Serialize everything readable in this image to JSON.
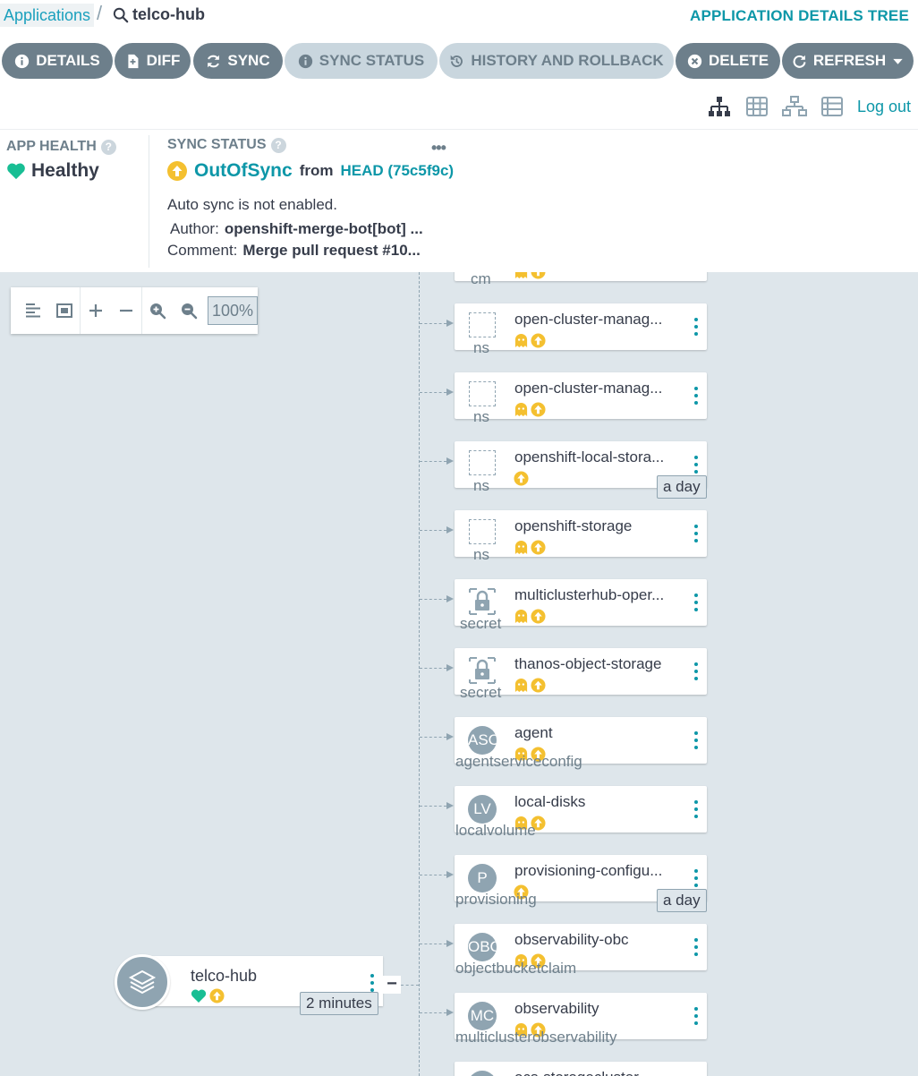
{
  "breadcrumb": {
    "apps": "Applications",
    "current": "telco-hub"
  },
  "view_title": "APPLICATION DETAILS TREE",
  "toolbar": {
    "details": "DETAILS",
    "diff": "DIFF",
    "sync": "SYNC",
    "sync_status": "SYNC STATUS",
    "history": "HISTORY AND ROLLBACK",
    "delete": "DELETE",
    "refresh": "REFRESH"
  },
  "logout": "Log out",
  "app_health": {
    "title": "APP HEALTH",
    "value": "Healthy"
  },
  "sync_status": {
    "title": "SYNC STATUS",
    "value": "OutOfSync",
    "from": "from",
    "revision": "HEAD (75c5f9c)",
    "auto_sync": "Auto sync is not enabled.",
    "author_label": "Author:",
    "author": "openshift-merge-bot[bot] ...",
    "comment_label": "Comment:",
    "comment": "Merge pull request #10..."
  },
  "zoom": {
    "level": "100%"
  },
  "colors": {
    "accent": "#0d97a8",
    "healthy": "#18be94",
    "outofsync": "#f4c030",
    "muted": "#8fa4b1"
  },
  "partial_top_kind": "cm",
  "nodes": [
    {
      "name": "open-cluster-manag...",
      "kind": "ns",
      "icon": "namespace-icon",
      "ghost": true,
      "age": ""
    },
    {
      "name": "open-cluster-manag...",
      "kind": "ns",
      "icon": "namespace-icon",
      "ghost": true,
      "age": ""
    },
    {
      "name": "openshift-local-stora...",
      "kind": "ns",
      "icon": "namespace-icon",
      "ghost": false,
      "age": "a day"
    },
    {
      "name": "openshift-storage",
      "kind": "ns",
      "icon": "namespace-icon",
      "ghost": true,
      "age": ""
    },
    {
      "name": "multiclusterhub-oper...",
      "kind": "secret",
      "icon": "secret-icon",
      "ghost": true,
      "age": ""
    },
    {
      "name": "thanos-object-storage",
      "kind": "secret",
      "icon": "secret-icon",
      "ghost": true,
      "age": ""
    },
    {
      "name": "agent",
      "kind": "agentserviceconfig",
      "icon": "ASC",
      "ghost": true,
      "age": ""
    },
    {
      "name": "local-disks",
      "kind": "localvolume",
      "icon": "LV",
      "ghost": true,
      "age": ""
    },
    {
      "name": "provisioning-configu...",
      "kind": "provisioning",
      "icon": "P",
      "ghost": false,
      "age": "a day"
    },
    {
      "name": "observability-obc",
      "kind": "objectbucketclaim",
      "icon": "OBC",
      "ghost": true,
      "age": ""
    },
    {
      "name": "observability",
      "kind": "multiclusterobservability",
      "icon": "MC",
      "ghost": true,
      "age": ""
    },
    {
      "name": "ocs-storagecluster",
      "kind": "",
      "icon": "SC",
      "ghost": false,
      "age": ""
    }
  ],
  "root": {
    "name": "telco-hub",
    "age": "2 minutes"
  }
}
